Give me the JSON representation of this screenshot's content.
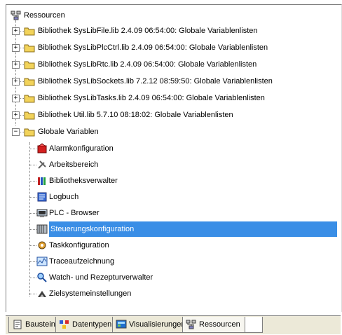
{
  "tree": {
    "root_label": "Ressourcen",
    "libraries": [
      "Bibliothek SysLibFile.lib 2.4.09 06:54:00: Globale Variablenlisten",
      "Bibliothek SysLibPlcCtrl.lib 2.4.09 06:54:00: Globale Variablenlisten",
      "Bibliothek SysLibRtc.lib 2.4.09 06:54:00: Globale Variablenlisten",
      "Bibliothek SysLibSockets.lib 7.2.12 08:59:50: Globale Variablenlisten",
      "Bibliothek SysLibTasks.lib 2.4.09 06:54:00: Globale Variablenlisten",
      "Bibliothek Util.lib 5.7.10 08:18:02: Globale Variablenlisten"
    ],
    "globals_label": "Globale Variablen",
    "items": [
      {
        "label": "Alarmkonfiguration",
        "icon": "alarm-config-icon"
      },
      {
        "label": "Arbeitsbereich",
        "icon": "workspace-tools-icon"
      },
      {
        "label": "Bibliotheksverwalter",
        "icon": "library-manager-icon"
      },
      {
        "label": "Logbuch",
        "icon": "logbook-icon"
      },
      {
        "label": "PLC - Browser",
        "icon": "plc-browser-icon"
      },
      {
        "label": "Steuerungskonfiguration",
        "icon": "controller-config-icon"
      },
      {
        "label": "Taskkonfiguration",
        "icon": "task-config-icon"
      },
      {
        "label": "Traceaufzeichnung",
        "icon": "trace-recording-icon"
      },
      {
        "label": "Watch- und Rezepturverwalter",
        "icon": "watch-recipe-icon"
      },
      {
        "label": "Zielsystemeinstellungen",
        "icon": "target-settings-icon"
      }
    ],
    "selected_item": "Steuerungskonfiguration",
    "expand_symbol": "+",
    "collapse_symbol": "−"
  },
  "tabs": [
    {
      "label": "Bausteine",
      "icon": "pou-icon"
    },
    {
      "label": "Datentypen",
      "icon": "datatypes-icon"
    },
    {
      "label": "Visualisierungen",
      "icon": "visualization-icon"
    },
    {
      "label": "Ressourcen",
      "icon": "resources-icon",
      "active": true
    }
  ],
  "colors": {
    "selection": "#3a8ee6",
    "folder": "#f2d35a"
  }
}
